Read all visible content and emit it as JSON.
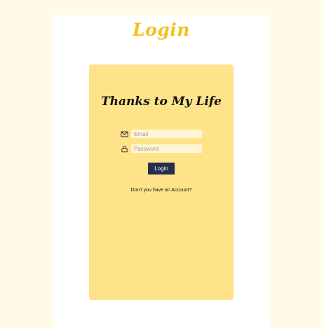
{
  "header": {
    "title": "Login"
  },
  "card": {
    "heading": "Thanks to My Life",
    "email": {
      "icon": "mail-icon",
      "placeholder": "Email",
      "value": ""
    },
    "password": {
      "icon": "lock-icon",
      "placeholder": "Password",
      "value": ""
    },
    "login_label": "Login",
    "signup_text": "Don't you have an Account?"
  },
  "colors": {
    "background": "#fffbe8",
    "title": "#f3c21c",
    "card": "#ffe38b",
    "button": "#243049"
  }
}
